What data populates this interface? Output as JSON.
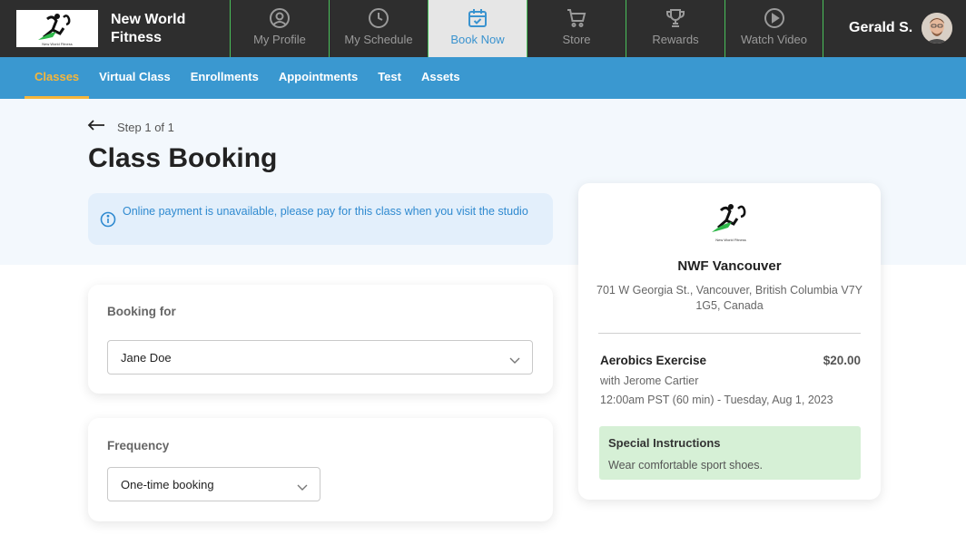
{
  "brand": {
    "name_line1": "New World",
    "name_line2": "Fitness",
    "logo_caption": "New World Fitness"
  },
  "nav": {
    "items": [
      {
        "label": "My Profile",
        "icon": "user-circle-icon",
        "active": false
      },
      {
        "label": "My Schedule",
        "icon": "clock-icon",
        "active": false
      },
      {
        "label": "Book Now",
        "icon": "calendar-check-icon",
        "active": true
      },
      {
        "label": "Store",
        "icon": "shopping-cart-icon",
        "active": false
      },
      {
        "label": "Rewards",
        "icon": "trophy-icon",
        "active": false
      },
      {
        "label": "Watch Video",
        "icon": "play-circle-icon",
        "active": false
      }
    ]
  },
  "user": {
    "name": "Gerald S."
  },
  "subnav": {
    "items": [
      {
        "label": "Classes",
        "active": true
      },
      {
        "label": "Virtual Class",
        "active": false
      },
      {
        "label": "Enrollments",
        "active": false
      },
      {
        "label": "Appointments",
        "active": false
      },
      {
        "label": "Test",
        "active": false
      },
      {
        "label": "Assets",
        "active": false
      }
    ]
  },
  "page": {
    "step": "Step 1 of 1",
    "title": "Class Booking",
    "alert": "Online payment is unavailable, please pay for this class when you visit the studio"
  },
  "booking_for": {
    "label": "Booking for",
    "value": "Jane Doe"
  },
  "frequency": {
    "label": "Frequency",
    "value": "One-time booking"
  },
  "summary": {
    "studio_name": "NWF Vancouver",
    "address": "701 W Georgia St., Vancouver, British Columbia V7Y 1G5, Canada",
    "class_name": "Aerobics Exercise",
    "price": "$20.00",
    "instructor": "with Jerome Cartier",
    "when": "12:00am PST (60 min) - Tuesday, Aug 1, 2023",
    "instructions_title": "Special Instructions",
    "instructions_text": "Wear comfortable sport shoes."
  },
  "colors": {
    "topbar": "#2e2e2e",
    "nav_border": "#49c05a",
    "accent_blue": "#3a98d0",
    "active_tab": "#f5b63c",
    "instructions_bg": "#d6f0d6"
  }
}
